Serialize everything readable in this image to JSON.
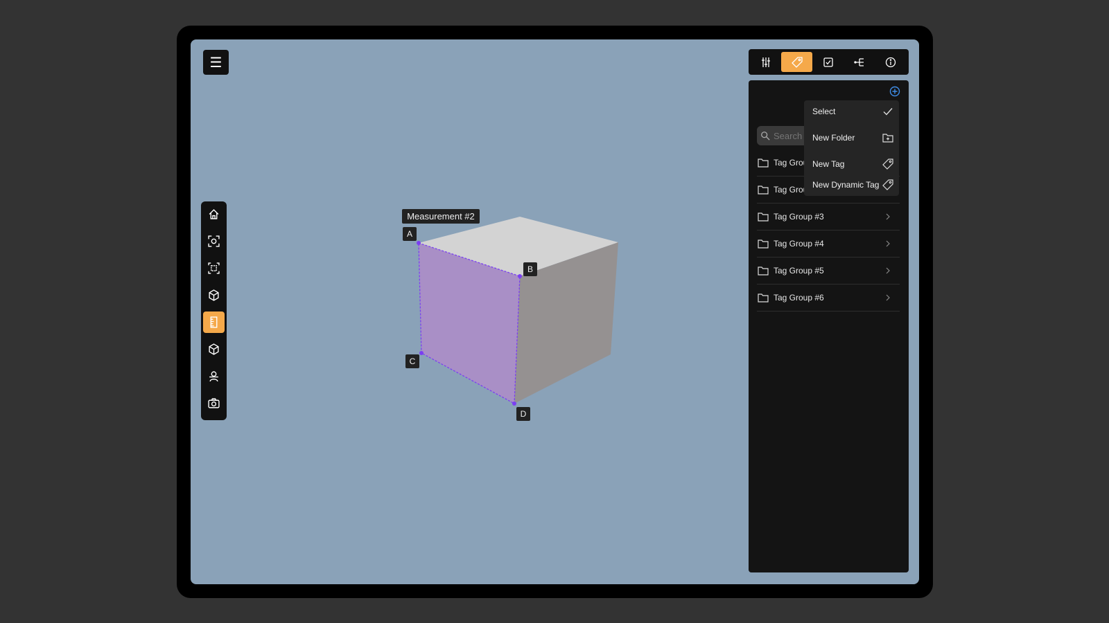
{
  "app": {
    "menu_glyph": "☰"
  },
  "toolbar": {
    "items": [
      {
        "icon": "home-icon"
      },
      {
        "icon": "focus-icon"
      },
      {
        "icon": "frame-select-icon"
      },
      {
        "icon": "box-view-icon"
      },
      {
        "icon": "ruler-icon",
        "active": true
      },
      {
        "icon": "cube-icon"
      },
      {
        "icon": "person-icon"
      },
      {
        "icon": "camera-icon"
      }
    ]
  },
  "topbar": {
    "tabs": [
      {
        "icon": "sliders-icon"
      },
      {
        "icon": "tag-icon",
        "active": true
      },
      {
        "icon": "checkbox-icon"
      },
      {
        "icon": "hierarchy-icon"
      },
      {
        "icon": "info-icon"
      }
    ]
  },
  "panel": {
    "search_placeholder": "Search",
    "groups": [
      {
        "label": "Tag Group #1"
      },
      {
        "label": "Tag Group #2"
      },
      {
        "label": "Tag Group #3"
      },
      {
        "label": "Tag Group #4"
      },
      {
        "label": "Tag Group #5"
      },
      {
        "label": "Tag Group #6"
      }
    ],
    "add_icon": "add-circle-icon"
  },
  "dropdown": {
    "items": [
      {
        "label": "Select",
        "icon": "check-icon"
      },
      {
        "label": "New Folder",
        "icon": "folder-add-icon"
      },
      {
        "label": "New Tag",
        "icon": "tag-icon"
      },
      {
        "label": "New Dynamic Tag",
        "icon": "tag-icon"
      }
    ]
  },
  "viewport": {
    "measurement_label": "Measurement #2",
    "points": [
      "A",
      "B",
      "C",
      "D"
    ]
  },
  "colors": {
    "accent": "#f5a94a",
    "background": "#8aa2b8",
    "measure_face": "#a98fc6",
    "measure_line": "#7b3ff2",
    "add_blue": "#3f8ee8"
  }
}
